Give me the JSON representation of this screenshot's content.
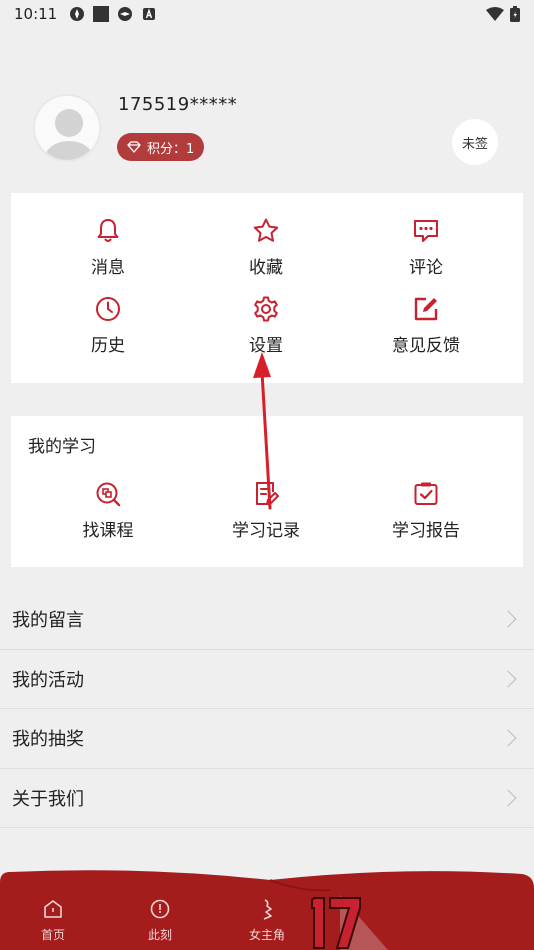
{
  "status_bar": {
    "time": "10:11"
  },
  "profile": {
    "username": "175519*****",
    "points_label": "积分：1",
    "sign_label": "未签"
  },
  "quick_grid": [
    {
      "label": "消息",
      "icon": "bell-icon"
    },
    {
      "label": "收藏",
      "icon": "star-icon"
    },
    {
      "label": "评论",
      "icon": "comment-icon"
    },
    {
      "label": "历史",
      "icon": "clock-icon"
    },
    {
      "label": "设置",
      "icon": "gear-icon"
    },
    {
      "label": "意见反馈",
      "icon": "edit-icon"
    }
  ],
  "learning": {
    "title": "我的学习",
    "items": [
      {
        "label": "找课程",
        "icon": "search-course-icon"
      },
      {
        "label": "学习记录",
        "icon": "record-icon"
      },
      {
        "label": "学习报告",
        "icon": "report-icon"
      }
    ]
  },
  "menu_list": [
    {
      "label": "我的留言"
    },
    {
      "label": "我的活动"
    },
    {
      "label": "我的抽奖"
    },
    {
      "label": "关于我们"
    }
  ],
  "tabs": [
    {
      "label": "首页",
      "icon": "home-icon"
    },
    {
      "label": "此刻",
      "icon": "clock-compass-icon"
    },
    {
      "label": "女主角",
      "icon": "figure-icon"
    }
  ],
  "colors": {
    "accent": "#c8212f",
    "tabbar": "#a51c1c",
    "badge": "#b23c3c"
  }
}
